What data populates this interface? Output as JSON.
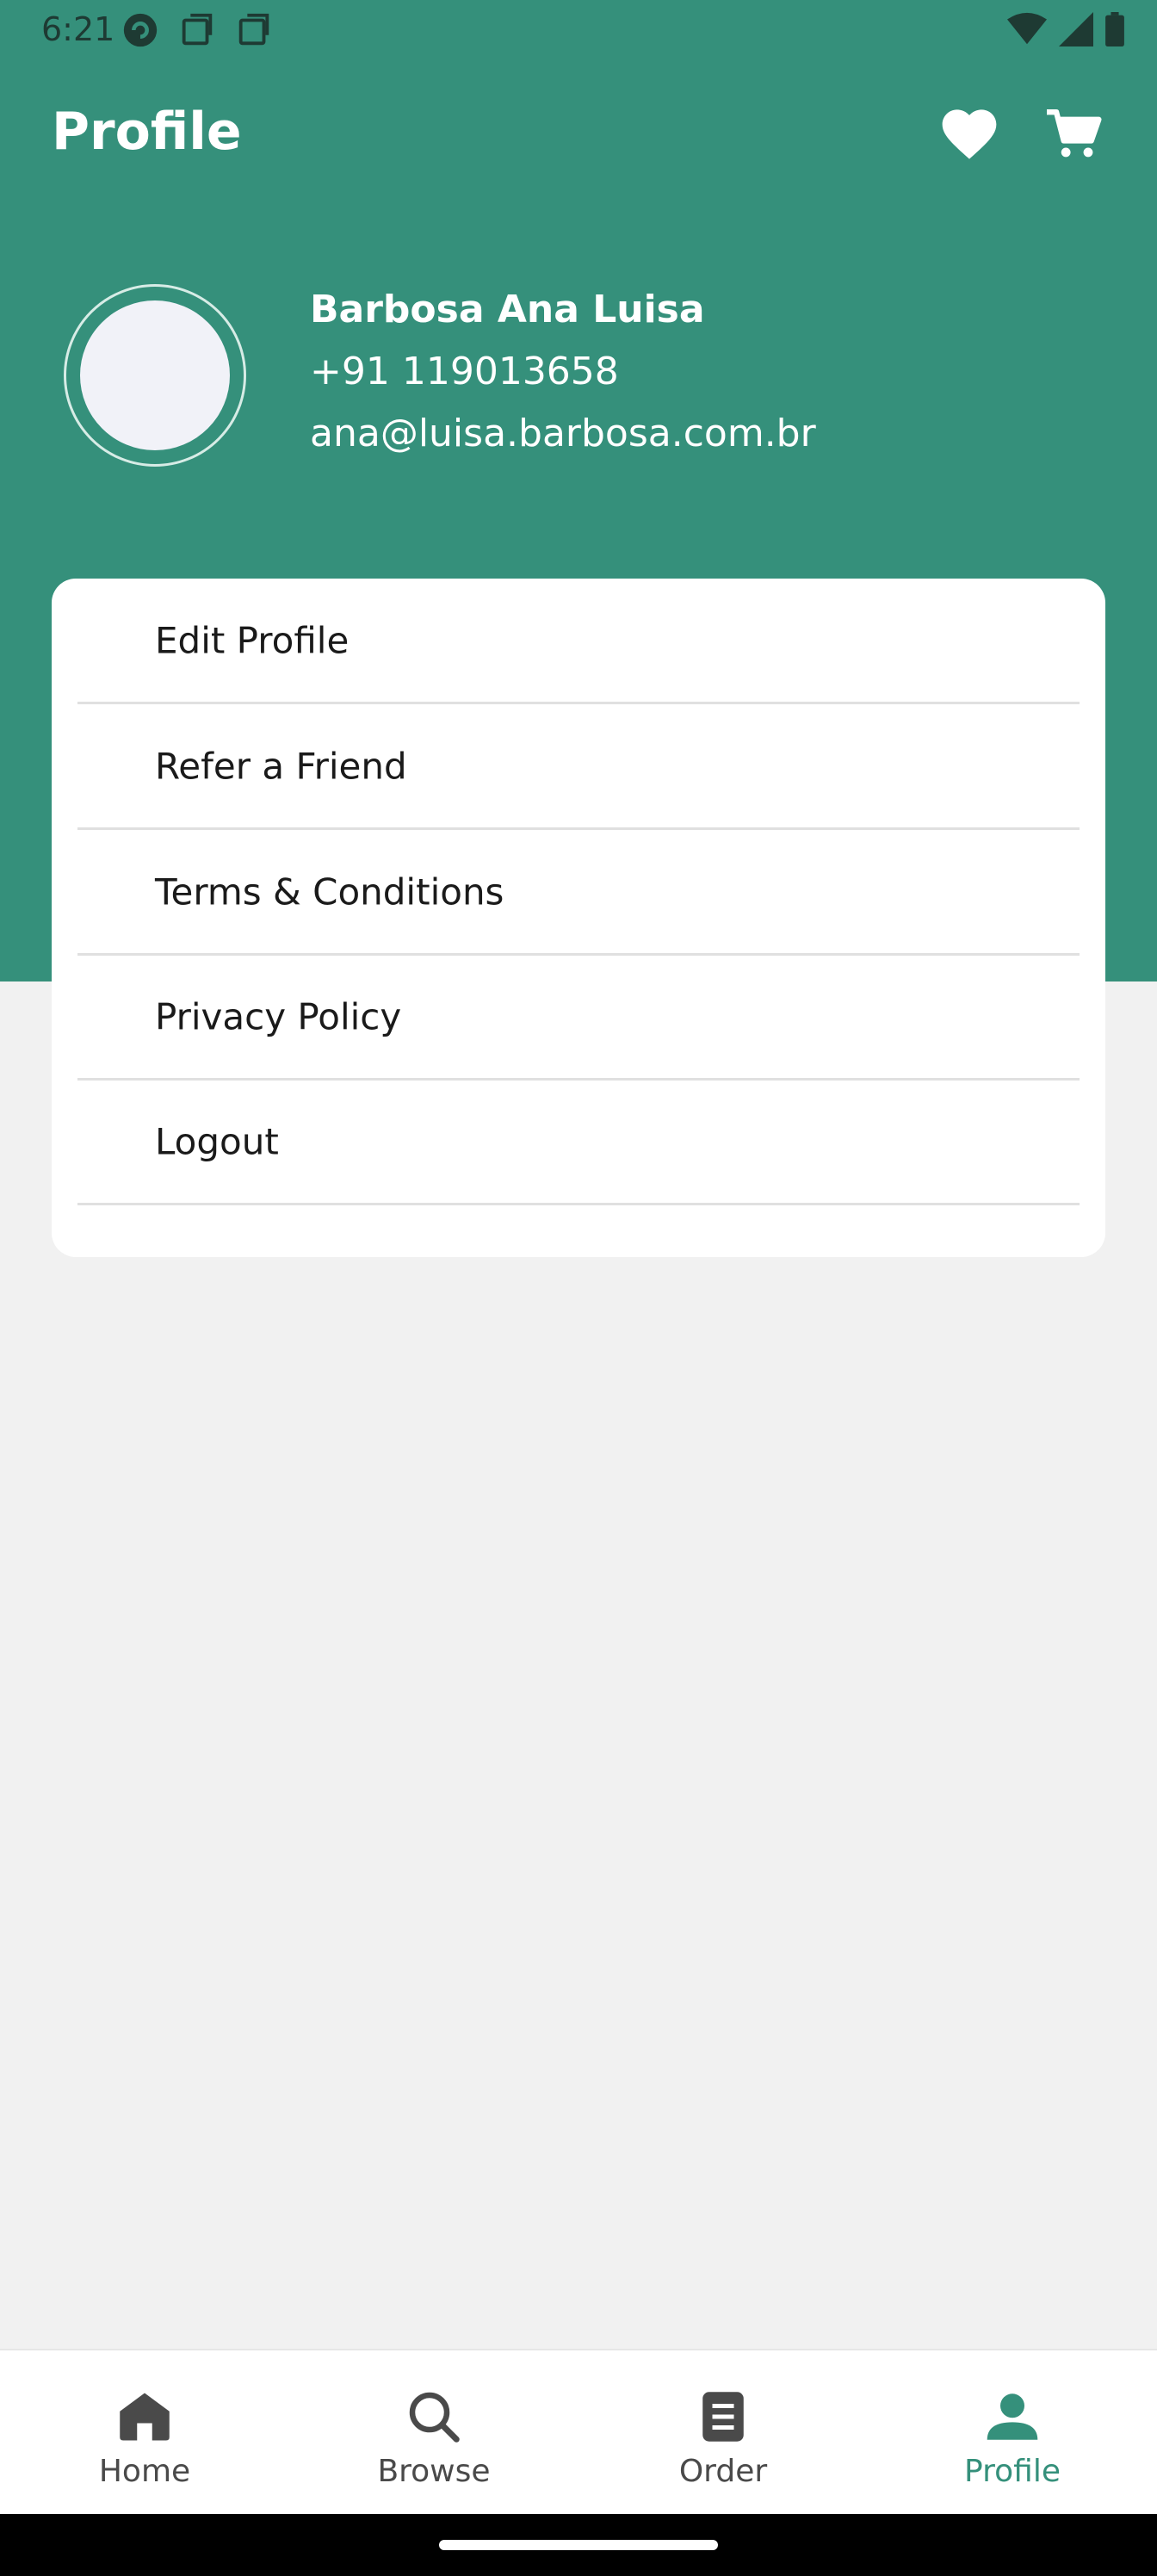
{
  "status_bar": {
    "time": "6:21",
    "icons": [
      "app-notification-icon",
      "copy-icon",
      "copy-icon",
      "wifi-icon",
      "signal-icon",
      "battery-icon"
    ]
  },
  "app_bar": {
    "title": "Profile",
    "actions": [
      "heart-icon",
      "cart-icon"
    ]
  },
  "profile": {
    "name": "Barbosa Ana Luisa",
    "phone": "+91 119013658",
    "email": "ana@luisa.barbosa.com.br"
  },
  "menu": {
    "items": [
      {
        "label": "Edit Profile"
      },
      {
        "label": "Refer a Friend"
      },
      {
        "label": "Terms & Conditions"
      },
      {
        "label": "Privacy Policy"
      },
      {
        "label": "Logout"
      }
    ]
  },
  "bottom_nav": {
    "items": [
      {
        "label": "Home",
        "icon": "home-icon"
      },
      {
        "label": "Browse",
        "icon": "search-icon"
      },
      {
        "label": "Order",
        "icon": "document-icon"
      },
      {
        "label": "Profile",
        "icon": "person-icon"
      }
    ],
    "active": "Profile"
  },
  "colors": {
    "primary": "#35907B",
    "background": "#F1F1F1",
    "surface": "#FFFFFF",
    "text": "#1A1A1A"
  }
}
